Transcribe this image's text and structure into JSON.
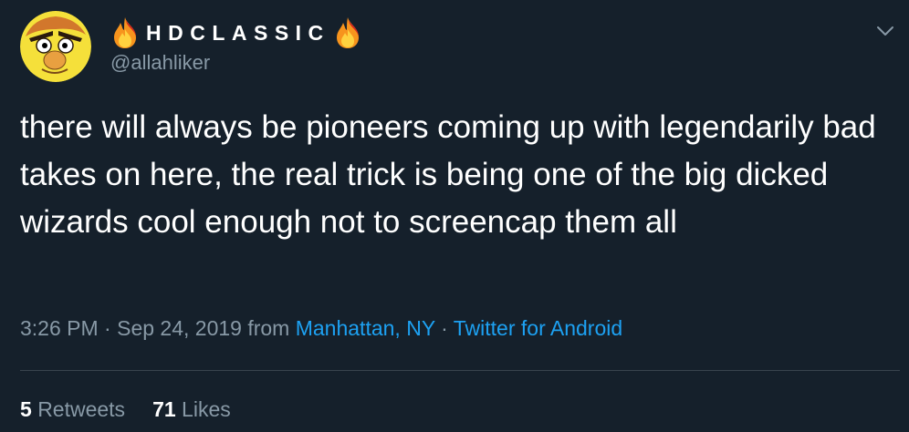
{
  "user": {
    "display_name": "HDCLASSIC",
    "handle": "@allahliker",
    "avatar_icon": "cartoon-face-avatar",
    "name_emoji_icon": "fire-icon"
  },
  "tweet": {
    "text": "there will always be pioneers coming up with legendarily bad takes on here, the real trick is being one of the big dicked wizards cool enough not to screencap them all"
  },
  "meta": {
    "time": "3:26 PM",
    "sep1": " · ",
    "date": "Sep 24, 2019",
    "from_label": " from ",
    "location": "Manhattan, NY",
    "sep2": " · ",
    "source": "Twitter for Android"
  },
  "stats": {
    "retweets_count": "5",
    "retweets_label": "Retweets",
    "likes_count": "71",
    "likes_label": "Likes"
  },
  "colors": {
    "background": "#15202b",
    "secondary_text": "#8899a6",
    "link": "#1da1f2",
    "divider": "#38444d"
  }
}
